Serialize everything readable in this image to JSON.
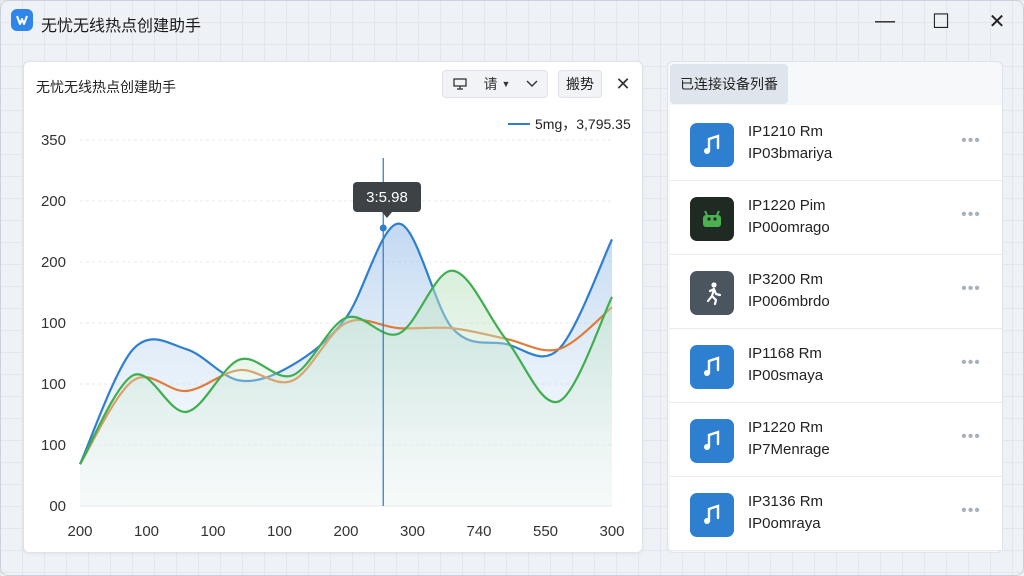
{
  "app": {
    "title": "无忧无线热点创建助手"
  },
  "window_controls": {
    "minimize": "—",
    "maximize": "☐",
    "close": "✕"
  },
  "chart_panel": {
    "title": "无忧无线热点创建助手",
    "tool_filter_label": "请",
    "switch_label": "搬势",
    "close_label": "✕",
    "legend_label": "5mg，3,795.35",
    "tooltip": "3:5.98"
  },
  "chart_data": {
    "type": "line",
    "x_tick_labels": [
      "200",
      "100",
      "100",
      "100",
      "200",
      "300",
      "740",
      "550",
      "300"
    ],
    "y_tick_labels": [
      "350",
      "200",
      "200",
      "100",
      "100",
      "100",
      "00"
    ],
    "cursor_index": 20,
    "series": [
      {
        "color": "#2f7fd0",
        "values": [
          40,
          150,
          150,
          120,
          135,
          180,
          270,
          170,
          155,
          150,
          255
        ]
      },
      {
        "color": "#e07b39",
        "values": [
          40,
          120,
          110,
          130,
          120,
          175,
          170,
          170,
          160,
          150,
          190
        ]
      },
      {
        "color": "#3fae4f",
        "values": [
          40,
          125,
          90,
          140,
          125,
          180,
          165,
          225,
          160,
          100,
          200
        ]
      }
    ]
  },
  "device_panel": {
    "tab_label": "已连接设备列番",
    "items": [
      {
        "name": "IP1210 Rm",
        "sub": "IP03bmariya",
        "icon": "music-note-icon",
        "color": "#2f7fd0"
      },
      {
        "name": "IP1220 Pim",
        "sub": "IP00omrago",
        "icon": "android-robot-icon",
        "color": "#1f2a22"
      },
      {
        "name": "IP3200 Rm",
        "sub": "IP006mbrdo",
        "icon": "running-person-icon",
        "color": "#4a5560"
      },
      {
        "name": "IP1168 Rm",
        "sub": "IP00smaya",
        "icon": "music-note-icon",
        "color": "#2f7fd0"
      },
      {
        "name": "IP1220 Rm",
        "sub": "IP7Menrage",
        "icon": "music-note-icon",
        "color": "#2f7fd0"
      },
      {
        "name": "IP3136 Rm",
        "sub": "IP0omraya",
        "icon": "music-note-icon",
        "color": "#2f7fd0"
      }
    ],
    "more_label": "•••"
  }
}
